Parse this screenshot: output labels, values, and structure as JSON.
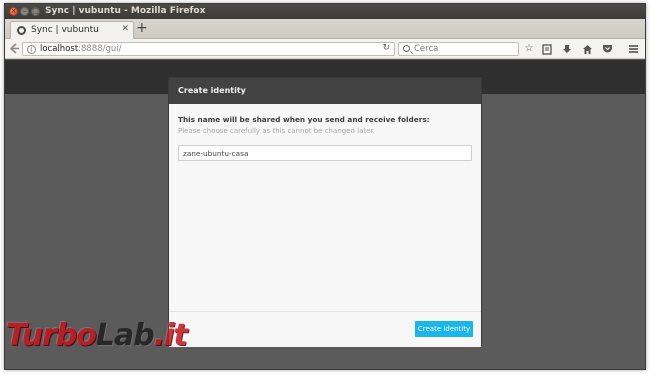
{
  "window": {
    "title": "Sync | vubuntu - Mozilla Firefox"
  },
  "tabs": [
    {
      "label": "Sync | vubuntu"
    }
  ],
  "navbar": {
    "url_host": "localhost",
    "url_path": ":8888/gui/",
    "search_placeholder": "Cerca"
  },
  "modal": {
    "title": "Create identity",
    "message": "This name will be shared when you send and receive folders:",
    "hint": "Please choose carefully as this cannot be changed later.",
    "name_value": "zane-ubuntu-casa",
    "button_label": "Create identity"
  },
  "watermark": {
    "part1": "Turbo",
    "part2": "Lab",
    "part3": ".it"
  },
  "colors": {
    "accent_button": "#18b6ea",
    "modal_header": "#424242",
    "page_header": "#2f2f2f",
    "page_background": "#5b5b5b"
  },
  "icons": [
    "close-icon",
    "minimize-icon",
    "maximize-icon",
    "favicon-icon",
    "tab-close-icon",
    "new-tab-icon",
    "back-icon",
    "info-icon",
    "reload-icon",
    "search-icon",
    "bookmark-star-icon",
    "reading-list-icon",
    "download-icon",
    "home-icon",
    "pocket-icon",
    "hamburger-menu-icon"
  ]
}
